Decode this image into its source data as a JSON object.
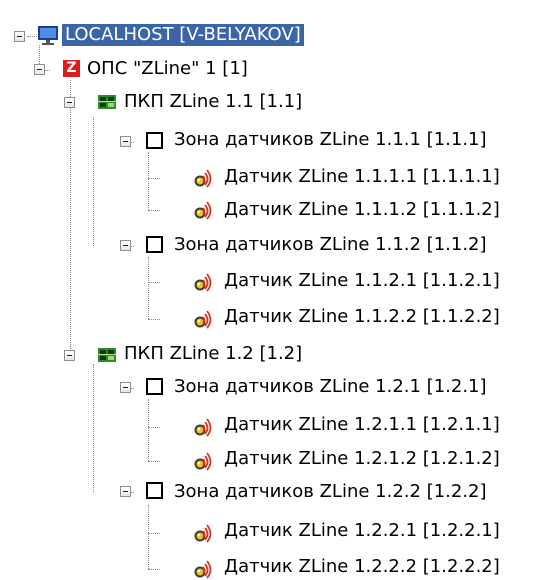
{
  "tree": {
    "root": {
      "label": "LOCALHOST [V-BELYAKOV]",
      "icon": "monitor-icon"
    },
    "ops": {
      "label": "ОПС \"ZLine\" 1 [1]",
      "icon": "z-logo-icon",
      "icon_text": "Z"
    },
    "pkp1": {
      "label": "ПКП ZLine 1.1 [1.1]",
      "icon": "circuit-board-icon"
    },
    "zone111": {
      "label": "Зона датчиков ZLine 1.1.1 [1.1.1]",
      "icon": "zone-square-icon"
    },
    "s1111": {
      "label": "Датчик ZLine 1.1.1.1 [1.1.1.1]",
      "icon": "sensor-signal-icon"
    },
    "s1112": {
      "label": "Датчик ZLine 1.1.1.2 [1.1.1.2]",
      "icon": "sensor-signal-icon"
    },
    "zone112": {
      "label": "Зона датчиков ZLine 1.1.2 [1.1.2]",
      "icon": "zone-square-icon"
    },
    "s1121": {
      "label": "Датчик ZLine 1.1.2.1 [1.1.2.1]",
      "icon": "sensor-signal-icon"
    },
    "s1122": {
      "label": "Датчик ZLine 1.1.2.2 [1.1.2.2]",
      "icon": "sensor-signal-icon"
    },
    "pkp2": {
      "label": "ПКП ZLine 1.2 [1.2]",
      "icon": "circuit-board-icon"
    },
    "zone121": {
      "label": "Зона датчиков ZLine 1.2.1 [1.2.1]",
      "icon": "zone-square-icon"
    },
    "s1211": {
      "label": "Датчик ZLine 1.2.1.1 [1.2.1.1]",
      "icon": "sensor-signal-icon"
    },
    "s1212": {
      "label": "Датчик ZLine 1.2.1.2 [1.2.1.2]",
      "icon": "sensor-signal-icon"
    },
    "zone122": {
      "label": "Зона датчиков ZLine 1.2.2 [1.2.2]",
      "icon": "zone-square-icon"
    },
    "s1221": {
      "label": "Датчик ZLine 1.2.2.1 [1.2.2.1]",
      "icon": "sensor-signal-icon"
    },
    "s1222": {
      "label": "Датчик ZLine 1.2.2.2 [1.2.2.2]",
      "icon": "sensor-signal-icon"
    }
  },
  "colors": {
    "selection": "#3c64a8",
    "ops_red": "#e01b1b"
  }
}
